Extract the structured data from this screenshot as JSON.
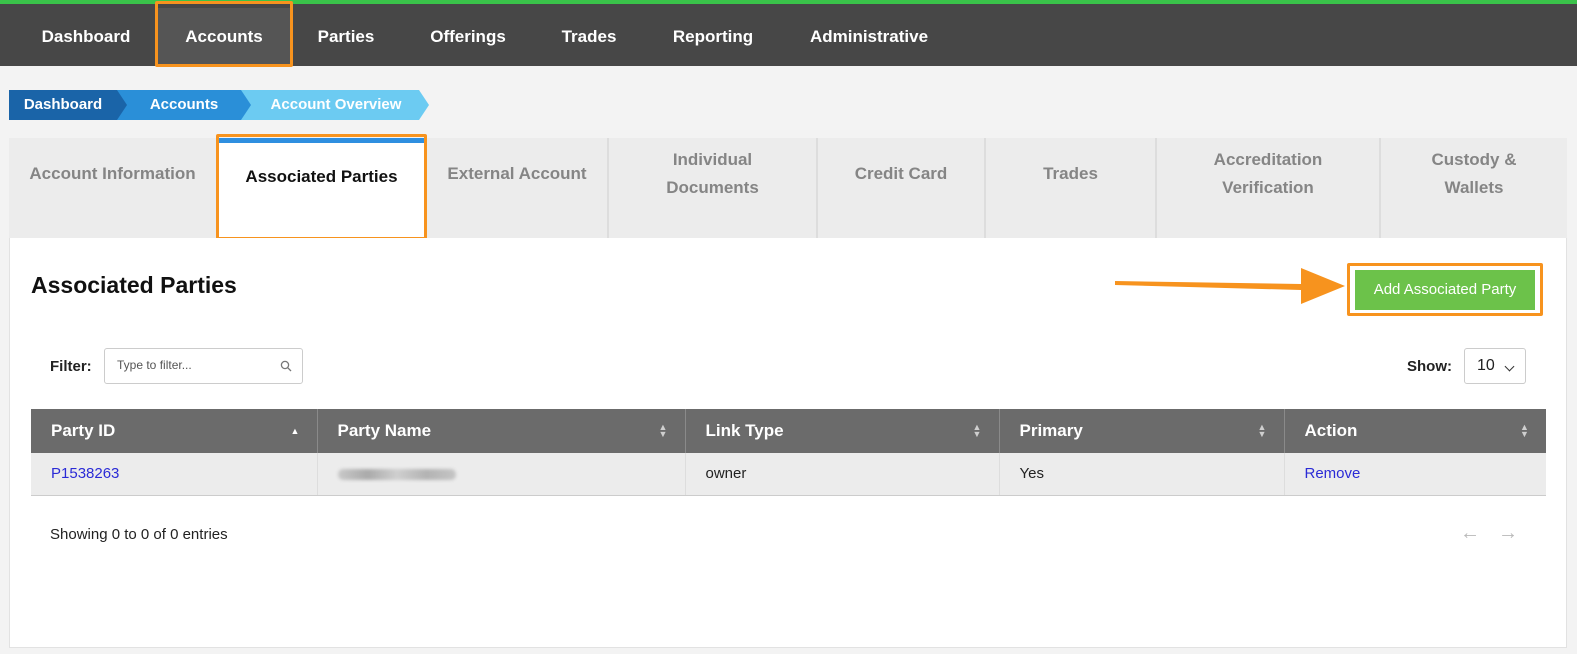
{
  "nav": {
    "items": [
      {
        "label": "Dashboard"
      },
      {
        "label": "Accounts"
      },
      {
        "label": "Parties"
      },
      {
        "label": "Offerings"
      },
      {
        "label": "Trades"
      },
      {
        "label": "Reporting"
      },
      {
        "label": "Administrative"
      }
    ],
    "active": "Accounts"
  },
  "breadcrumb": [
    {
      "label": "Dashboard"
    },
    {
      "label": "Accounts"
    },
    {
      "label": "Account Overview"
    }
  ],
  "tabs": [
    {
      "lines": [
        "Account Information"
      ]
    },
    {
      "lines": [
        "Associated Parties"
      ]
    },
    {
      "lines": [
        "External Account"
      ]
    },
    {
      "lines": [
        "Individual",
        "Documents"
      ]
    },
    {
      "lines": [
        "Credit Card"
      ]
    },
    {
      "lines": [
        "Trades"
      ]
    },
    {
      "lines": [
        "Accreditation",
        "Verification"
      ]
    },
    {
      "lines": [
        "Custody &",
        "Wallets"
      ]
    }
  ],
  "section": {
    "title": "Associated Parties",
    "add_button": "Add Associated Party"
  },
  "filter": {
    "label": "Filter:",
    "placeholder": "Type to filter...",
    "icon": "search-icon"
  },
  "show": {
    "label": "Show:",
    "value": "10"
  },
  "table": {
    "columns": [
      "Party ID",
      "Party Name",
      "Link Type",
      "Primary",
      "Action"
    ],
    "rows": [
      {
        "party_id": "P1538263",
        "party_name": "",
        "link_type": "owner",
        "primary": "Yes",
        "action": "Remove"
      }
    ]
  },
  "footer": {
    "showing": "Showing 0 to 0 of 0 entries",
    "prev": "←",
    "next": "→"
  },
  "colors": {
    "nav_bg": "#474747",
    "nav_accent": "#3ac34a",
    "highlight": "#f7931e",
    "add_button": "#6cc24a",
    "tab_active_bar": "#2f8fe0",
    "link": "#2b2bd6"
  }
}
